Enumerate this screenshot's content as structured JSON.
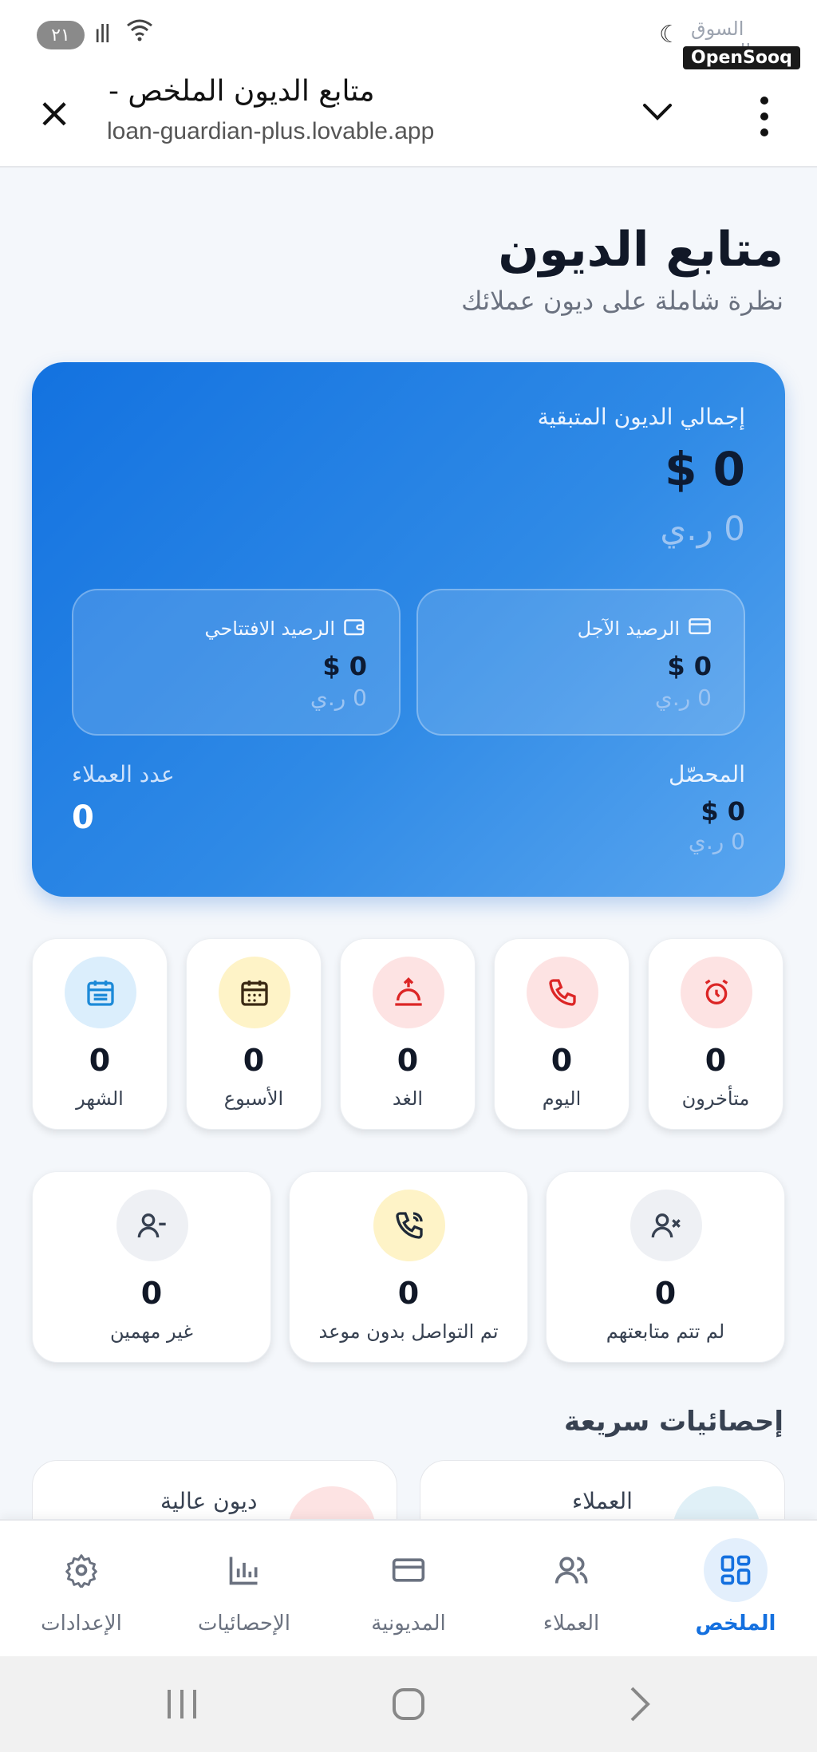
{
  "status_bar": {
    "pill": "٢١",
    "brand_faint": "السوق المفتوح",
    "brand": "OpenSooq"
  },
  "browser": {
    "page_title": "متابع الديون الملخص -",
    "url": "loan-guardian-plus.lovable.app"
  },
  "header": {
    "title": "متابع الديون",
    "subtitle": "نظرة شاملة على ديون عملائك"
  },
  "summary_card": {
    "total_label": "إجمالي الديون المتبقية",
    "total_amount": "$ 0",
    "total_sub": "0 ر.ي",
    "deferred": {
      "label": "الرصيد الآجل",
      "amount": "$ 0",
      "sub": "0 ر.ي"
    },
    "opening": {
      "label": "الرصيد الافتتاحي",
      "amount": "$ 0",
      "sub": "0 ر.ي"
    },
    "collected": {
      "label": "المحصّل",
      "amount": "$ 0",
      "sub": "0 ر.ي"
    },
    "clients_count": {
      "label": "عدد العملاء",
      "value": "0"
    }
  },
  "stats_row1": [
    {
      "label": "متأخرون",
      "value": "0",
      "icon": "alarm-icon"
    },
    {
      "label": "اليوم",
      "value": "0",
      "icon": "phone-icon"
    },
    {
      "label": "الغد",
      "value": "0",
      "icon": "sunrise-icon"
    },
    {
      "label": "الأسبوع",
      "value": "0",
      "icon": "calendar-week-icon"
    },
    {
      "label": "الشهر",
      "value": "0",
      "icon": "calendar-month-icon"
    }
  ],
  "stats_row2": [
    {
      "label": "لم تتم متابعتهم",
      "value": "0",
      "icon": "user-x-icon"
    },
    {
      "label": "تم التواصل بدون موعد",
      "value": "0",
      "icon": "phone-call-icon"
    },
    {
      "label": "غير مهمين",
      "value": "0",
      "icon": "user-minus-icon"
    }
  ],
  "quick_stats": {
    "title": "إحصائيات سريعة",
    "items": [
      {
        "label": "العملاء"
      },
      {
        "label": "ديون عالية"
      }
    ]
  },
  "nav": [
    {
      "label": "الملخص",
      "active": true
    },
    {
      "label": "العملاء",
      "active": false
    },
    {
      "label": "المديونية",
      "active": false
    },
    {
      "label": "الإحصائيات",
      "active": false
    },
    {
      "label": "الإعدادات",
      "active": false
    }
  ],
  "colors": {
    "primary": "#1470df",
    "danger": "#dc2626",
    "warning_bg": "#fef3c7",
    "danger_bg": "#fde3e3",
    "info_bg": "#dbeefc",
    "neutral_bg": "#eef0f4"
  }
}
